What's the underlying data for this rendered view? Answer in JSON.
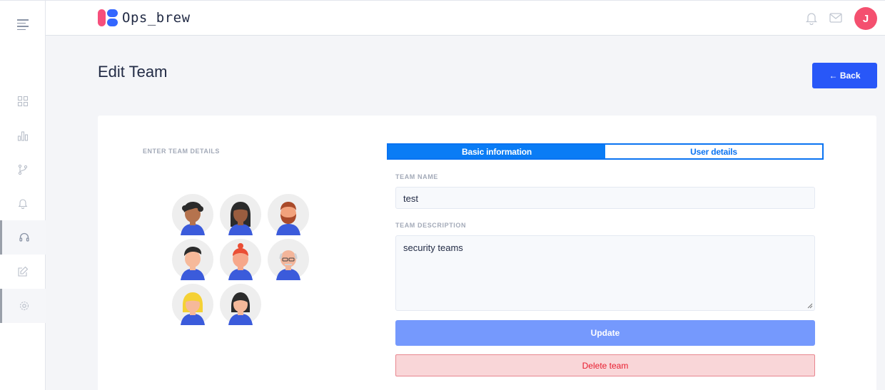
{
  "app": {
    "name": "Ops_brew"
  },
  "sidebar": {
    "items": [
      {
        "icon": "grid-icon"
      },
      {
        "icon": "bar-chart-icon"
      },
      {
        "icon": "branch-icon"
      },
      {
        "icon": "bell-icon"
      },
      {
        "icon": "headset-icon",
        "active": true
      },
      {
        "icon": "edit-icon"
      },
      {
        "icon": "settings-icon",
        "active": true
      }
    ]
  },
  "header": {
    "user_initial": "J",
    "avatar_color": "#f4506f"
  },
  "page": {
    "title": "Edit Team",
    "back_label": "← Back"
  },
  "form": {
    "section_label": "ENTER TEAM DETAILS",
    "tabs": [
      {
        "label": "Basic information",
        "active": true
      },
      {
        "label": "User details",
        "active": false
      }
    ],
    "team_name_label": "TEAM NAME",
    "team_name_value": "test",
    "team_description_label": "TEAM DESCRIPTION",
    "team_description_value": "security teams",
    "update_label": "Update",
    "delete_label": "Delete team"
  },
  "colors": {
    "primary": "#2857f8",
    "tab_active": "#0a7cf5",
    "update_button": "#7599fd",
    "danger_text": "#e81c2e",
    "danger_bg": "#f9d6d8"
  }
}
